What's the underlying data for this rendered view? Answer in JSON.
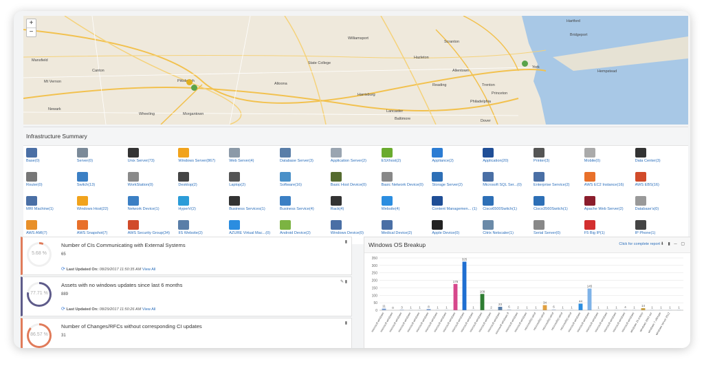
{
  "map": {
    "zoom_in": "+",
    "zoom_out": "−",
    "cities": [
      {
        "name": "Mansfield",
        "ml": 12,
        "mt": 62
      },
      {
        "name": "Mt Vernon",
        "ml": 30,
        "mt": 93
      },
      {
        "name": "Newark",
        "ml": 36,
        "mt": 133
      },
      {
        "name": "Canton",
        "ml": 100,
        "mt": 77
      },
      {
        "name": "Pittsburgh",
        "ml": 224,
        "mt": 92
      },
      {
        "name": "State College",
        "ml": 414,
        "mt": 66
      },
      {
        "name": "Williamsport",
        "ml": 472,
        "mt": 30
      },
      {
        "name": "Hazleton",
        "ml": 568,
        "mt": 58
      },
      {
        "name": "Allentown",
        "ml": 624,
        "mt": 77
      },
      {
        "name": "Harrisburg",
        "ml": 486,
        "mt": 112
      },
      {
        "name": "Lancaster",
        "ml": 528,
        "mt": 136
      },
      {
        "name": "Philadelphia",
        "ml": 650,
        "mt": 122
      },
      {
        "name": "Trenton",
        "ml": 667,
        "mt": 98
      },
      {
        "name": "Baltimore",
        "ml": 540,
        "mt": 147
      },
      {
        "name": "Scranton",
        "ml": 612,
        "mt": 35
      },
      {
        "name": "Morgantown",
        "ml": 232,
        "mt": 140
      },
      {
        "name": "Wheeling",
        "ml": 168,
        "mt": 140
      },
      {
        "name": "Bridgeport",
        "ml": 795,
        "mt": 25
      },
      {
        "name": "Hartford",
        "ml": 790,
        "mt": 5
      },
      {
        "name": "York",
        "ml": 740,
        "mt": 72
      },
      {
        "name": "Hempstead",
        "ml": 835,
        "mt": 78
      },
      {
        "name": "Princeton",
        "ml": 681,
        "mt": 110
      },
      {
        "name": "Reading",
        "ml": 595,
        "mt": 98
      },
      {
        "name": "Altoona",
        "ml": 365,
        "mt": 96
      },
      {
        "name": "Dover",
        "ml": 665,
        "mt": 150
      }
    ]
  },
  "infra": {
    "title": "Infrastructure Summary",
    "items": [
      {
        "label": "Base(0)",
        "color": "#4a6fa5",
        "r": 0,
        "c": 0
      },
      {
        "label": "Server(0)",
        "color": "#7b8a99",
        "r": 0,
        "c": 1
      },
      {
        "label": "Unix Server(73)",
        "color": "#333333",
        "r": 0,
        "c": 2
      },
      {
        "label": "Windows Server(867)",
        "color": "#f1a31c",
        "r": 0,
        "c": 3
      },
      {
        "label": "Web Server(4)",
        "color": "#8c9aa8",
        "r": 0,
        "c": 4
      },
      {
        "label": "Database Server(3)",
        "color": "#5a7ea8",
        "r": 0,
        "c": 5
      },
      {
        "label": "Application Server(2)",
        "color": "#9aa5b1",
        "r": 0,
        "c": 6
      },
      {
        "label": "ESXhost(2)",
        "color": "#6aab2e",
        "r": 0,
        "c": 7
      },
      {
        "label": "Appliance(2)",
        "color": "#2b7cd3",
        "r": 0,
        "c": 8
      },
      {
        "label": "Application(20)",
        "color": "#1f4e96",
        "r": 0,
        "c": 9
      },
      {
        "label": "Printer(3)",
        "color": "#555555",
        "r": 0,
        "c": 10
      },
      {
        "label": "Mobile(0)",
        "color": "#aaaaaa",
        "r": 0,
        "c": 11
      },
      {
        "label": "Data Center(3)",
        "color": "#333333",
        "r": 0,
        "c": 12
      },
      {
        "label": "Router(0)",
        "color": "#777777",
        "r": 1,
        "c": 0
      },
      {
        "label": "Switch(13)",
        "color": "#3b7fc4",
        "r": 1,
        "c": 1
      },
      {
        "label": "WorkStation(0)",
        "color": "#8a8a8a",
        "r": 1,
        "c": 2
      },
      {
        "label": "Desktop(2)",
        "color": "#444444",
        "r": 1,
        "c": 3
      },
      {
        "label": "Laptop(2)",
        "color": "#555555",
        "r": 1,
        "c": 4
      },
      {
        "label": "Software(16)",
        "color": "#4a90c8",
        "r": 1,
        "c": 5
      },
      {
        "label": "Basic Host Device(0)",
        "color": "#556b2f",
        "r": 1,
        "c": 6
      },
      {
        "label": "Basic Network Device(0)",
        "color": "#888888",
        "r": 1,
        "c": 7
      },
      {
        "label": "Storage Server(2)",
        "color": "#2d6fb6",
        "r": 1,
        "c": 8
      },
      {
        "label": "Microsoft SQL Ser...(0)",
        "color": "#4a6fa5",
        "r": 1,
        "c": 9
      },
      {
        "label": "Enterprise Service(2)",
        "color": "#4a6fa5",
        "r": 1,
        "c": 10
      },
      {
        "label": "AWS EC2 Instance(16)",
        "color": "#e8702a",
        "r": 1,
        "c": 11
      },
      {
        "label": "AWS EBS(16)",
        "color": "#d14b2a",
        "r": 1,
        "c": 12
      },
      {
        "label": "MRI Machine(1)",
        "color": "#4a6fa5",
        "r": 2,
        "c": 0
      },
      {
        "label": "Windows Host(22)",
        "color": "#f1a31c",
        "r": 2,
        "c": 1
      },
      {
        "label": "Network Device(1)",
        "color": "#3b7fc4",
        "r": 2,
        "c": 2
      },
      {
        "label": "HyperV(2)",
        "color": "#2b9cd8",
        "r": 2,
        "c": 3
      },
      {
        "label": "Business Services(1)",
        "color": "#333333",
        "r": 2,
        "c": 4
      },
      {
        "label": "Business Service(4)",
        "color": "#3b7fc4",
        "r": 2,
        "c": 5
      },
      {
        "label": "Rack(4)",
        "color": "#333333",
        "r": 2,
        "c": 6
      },
      {
        "label": "Website(4)",
        "color": "#2b8de0",
        "r": 2,
        "c": 7
      },
      {
        "label": "Content Managemen... (1)",
        "color": "#1f4e96",
        "r": 2,
        "c": 8
      },
      {
        "label": "Cisco6500Switch(1)",
        "color": "#2d6fb6",
        "r": 2,
        "c": 9
      },
      {
        "label": "Cisco3560Switch(1)",
        "color": "#2d6fb6",
        "r": 2,
        "c": 10
      },
      {
        "label": "Apache Web Server(2)",
        "color": "#8b1d2c",
        "r": 2,
        "c": 11
      },
      {
        "label": "Database's(0)",
        "color": "#999999",
        "r": 2,
        "c": 12
      },
      {
        "label": "AWS AMI(7)",
        "color": "#e8902a",
        "r": 3,
        "c": 0
      },
      {
        "label": "AWS Snapshot(7)",
        "color": "#e8702a",
        "r": 3,
        "c": 1
      },
      {
        "label": "AWS Security Group(34)",
        "color": "#d14b2a",
        "r": 3,
        "c": 2
      },
      {
        "label": "IIS Website(2)",
        "color": "#5a7ea8",
        "r": 3,
        "c": 3
      },
      {
        "label": "AZURE Virtual Mac...(0)",
        "color": "#2b8de0",
        "r": 3,
        "c": 4
      },
      {
        "label": "Android Device(2)",
        "color": "#7cb342",
        "r": 3,
        "c": 5
      },
      {
        "label": "Windows Device(0)",
        "color": "#4a6fa5",
        "r": 3,
        "c": 6
      },
      {
        "label": "Medical Device(2)",
        "color": "#4a6fa5",
        "r": 3,
        "c": 7
      },
      {
        "label": "Apple Device(0)",
        "color": "#222222",
        "r": 3,
        "c": 8
      },
      {
        "label": "Citrix Netscaler(1)",
        "color": "#6b8aa8",
        "r": 3,
        "c": 9
      },
      {
        "label": "Serial Server(0)",
        "color": "#888888",
        "r": 3,
        "c": 10
      },
      {
        "label": "F5 Big IP(1)",
        "color": "#d32f2f",
        "r": 3,
        "c": 11
      },
      {
        "label": "IP Phone(1)",
        "color": "#444444",
        "r": 3,
        "c": 12
      }
    ]
  },
  "widgets": [
    {
      "title": "Number of CIs Communicating with External Systems",
      "value": "65",
      "pct": "5.68 %",
      "pct_num": 5.68,
      "color": "#e07b5a",
      "updated_label": "Last Updated On:",
      "updated": "08/29/2017 11:50:35 AM",
      "view": "View All",
      "icons": "▮"
    },
    {
      "title": "Assets with no windows updates since last 6 months",
      "value": "889",
      "pct": "77.71 %",
      "pct_num": 77.71,
      "color": "#5e5b8a",
      "updated_label": "Last Updated On:",
      "updated": "08/29/2017 11:50:26 AM",
      "view": "View All",
      "icons": "✎ ▮"
    },
    {
      "title": "Number of Changes/RFCs without corresponding CI updates",
      "value": "31",
      "pct": "86.57 %",
      "pct_num": 86.57,
      "color": "#e07b5a",
      "updated_label": "",
      "updated": "",
      "view": "",
      "icons": "▮"
    }
  ],
  "chart": {
    "title": "Windows OS Breakup",
    "link": "Click for complete report",
    "tools": "⬇ ▮ ─ ▢",
    "chart_data": {
      "type": "bar",
      "ylim": [
        0,
        350
      ],
      "yticks": [
        0,
        50,
        100,
        150,
        200,
        250,
        300,
        350
      ],
      "values": [
        11,
        0,
        3,
        1,
        1,
        8,
        1,
        1,
        176,
        325,
        1,
        109,
        2,
        23,
        6,
        2,
        1,
        1,
        34,
        6,
        1,
        1,
        44,
        145,
        1,
        1,
        1,
        4,
        1,
        14,
        1,
        1,
        1,
        1
      ],
      "colors": [
        "#7b9fd4",
        "#c9d6ea",
        "#7b9fd4",
        "#c9d6ea",
        "#c9d6ea",
        "#7b9fd4",
        "#c9d6ea",
        "#c9d6ea",
        "#d6488c",
        "#1f6fd1",
        "#c9d6ea",
        "#2e7d32",
        "#c9d6ea",
        "#5a7ea8",
        "#c9d6ea",
        "#c9d6ea",
        "#c9d6ea",
        "#c9d6ea",
        "#e0a040",
        "#c9d6ea",
        "#c9d6ea",
        "#c9d6ea",
        "#2b8de0",
        "#7fb3e8",
        "#c9d6ea",
        "#c9d6ea",
        "#c9d6ea",
        "#c9d6ea",
        "#c9d6ea",
        "#c9a040",
        "#c9d6ea",
        "#c9d6ea",
        "#c9d6ea",
        "#c9d6ea"
      ],
      "categories": [
        "microsoft windows",
        "microsoft windows",
        "microsoft windows",
        "microsoft windows",
        "microsoft windows",
        "microsoft windows",
        "microsoft windows",
        "microsoft windows",
        "microsoft windows",
        "microsoft windows",
        "microsoft windows",
        "microsoft windows",
        "microsoft windows",
        "microsoft windows",
        "microsoft windows 8",
        "microsoft windows",
        "microsoft windows",
        "microsoft(r) wind",
        "microsoft(r) wind",
        "microsoft(r) wind",
        "microsoft(r) wind",
        "microsoft(r) wind",
        "microsoft windows",
        "microsoft windows",
        "microsoft windows",
        "microsoft windows",
        "microsoft windows",
        "microsoft windows",
        "microsoft windows",
        "windows 10 enterp",
        "windows 2003 ser",
        "windows 7 ultimate",
        "windows server 2012",
        ""
      ]
    }
  }
}
